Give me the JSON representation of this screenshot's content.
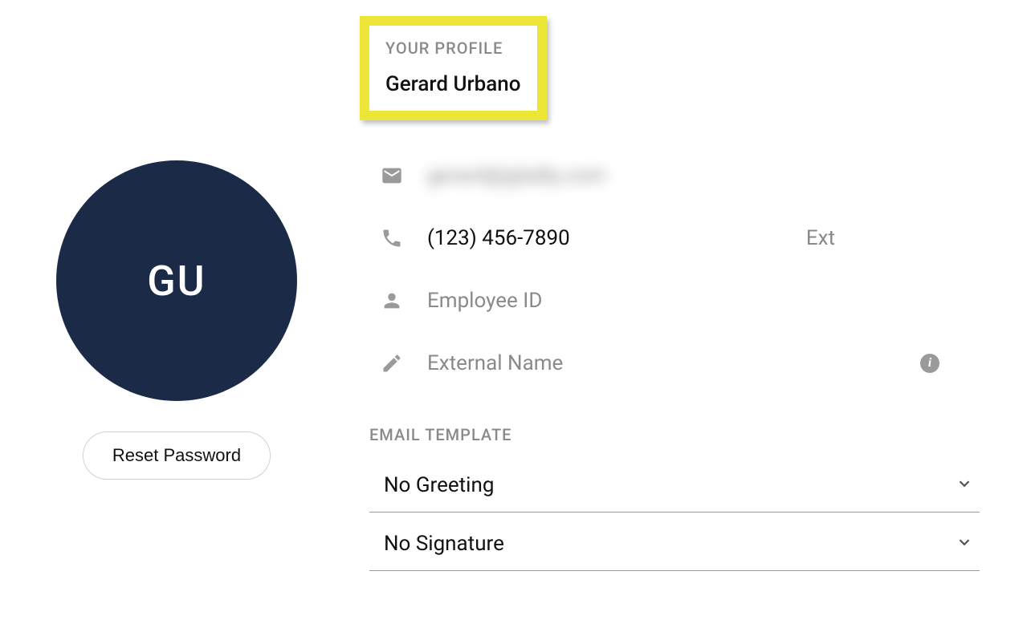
{
  "profile": {
    "section_label": "YOUR PROFILE",
    "name": "Gerard Urbano",
    "initials": "GU",
    "email_obscured": "gerard@gladly.com",
    "phone": "(123) 456-7890",
    "phone_ext_label": "Ext",
    "employee_id_placeholder": "Employee ID",
    "external_name_placeholder": "External Name"
  },
  "actions": {
    "reset_password_label": "Reset Password"
  },
  "email_template": {
    "section_label": "EMAIL TEMPLATE",
    "greeting_selected": "No Greeting",
    "signature_selected": "No Signature"
  },
  "icons": {
    "info": "i"
  }
}
